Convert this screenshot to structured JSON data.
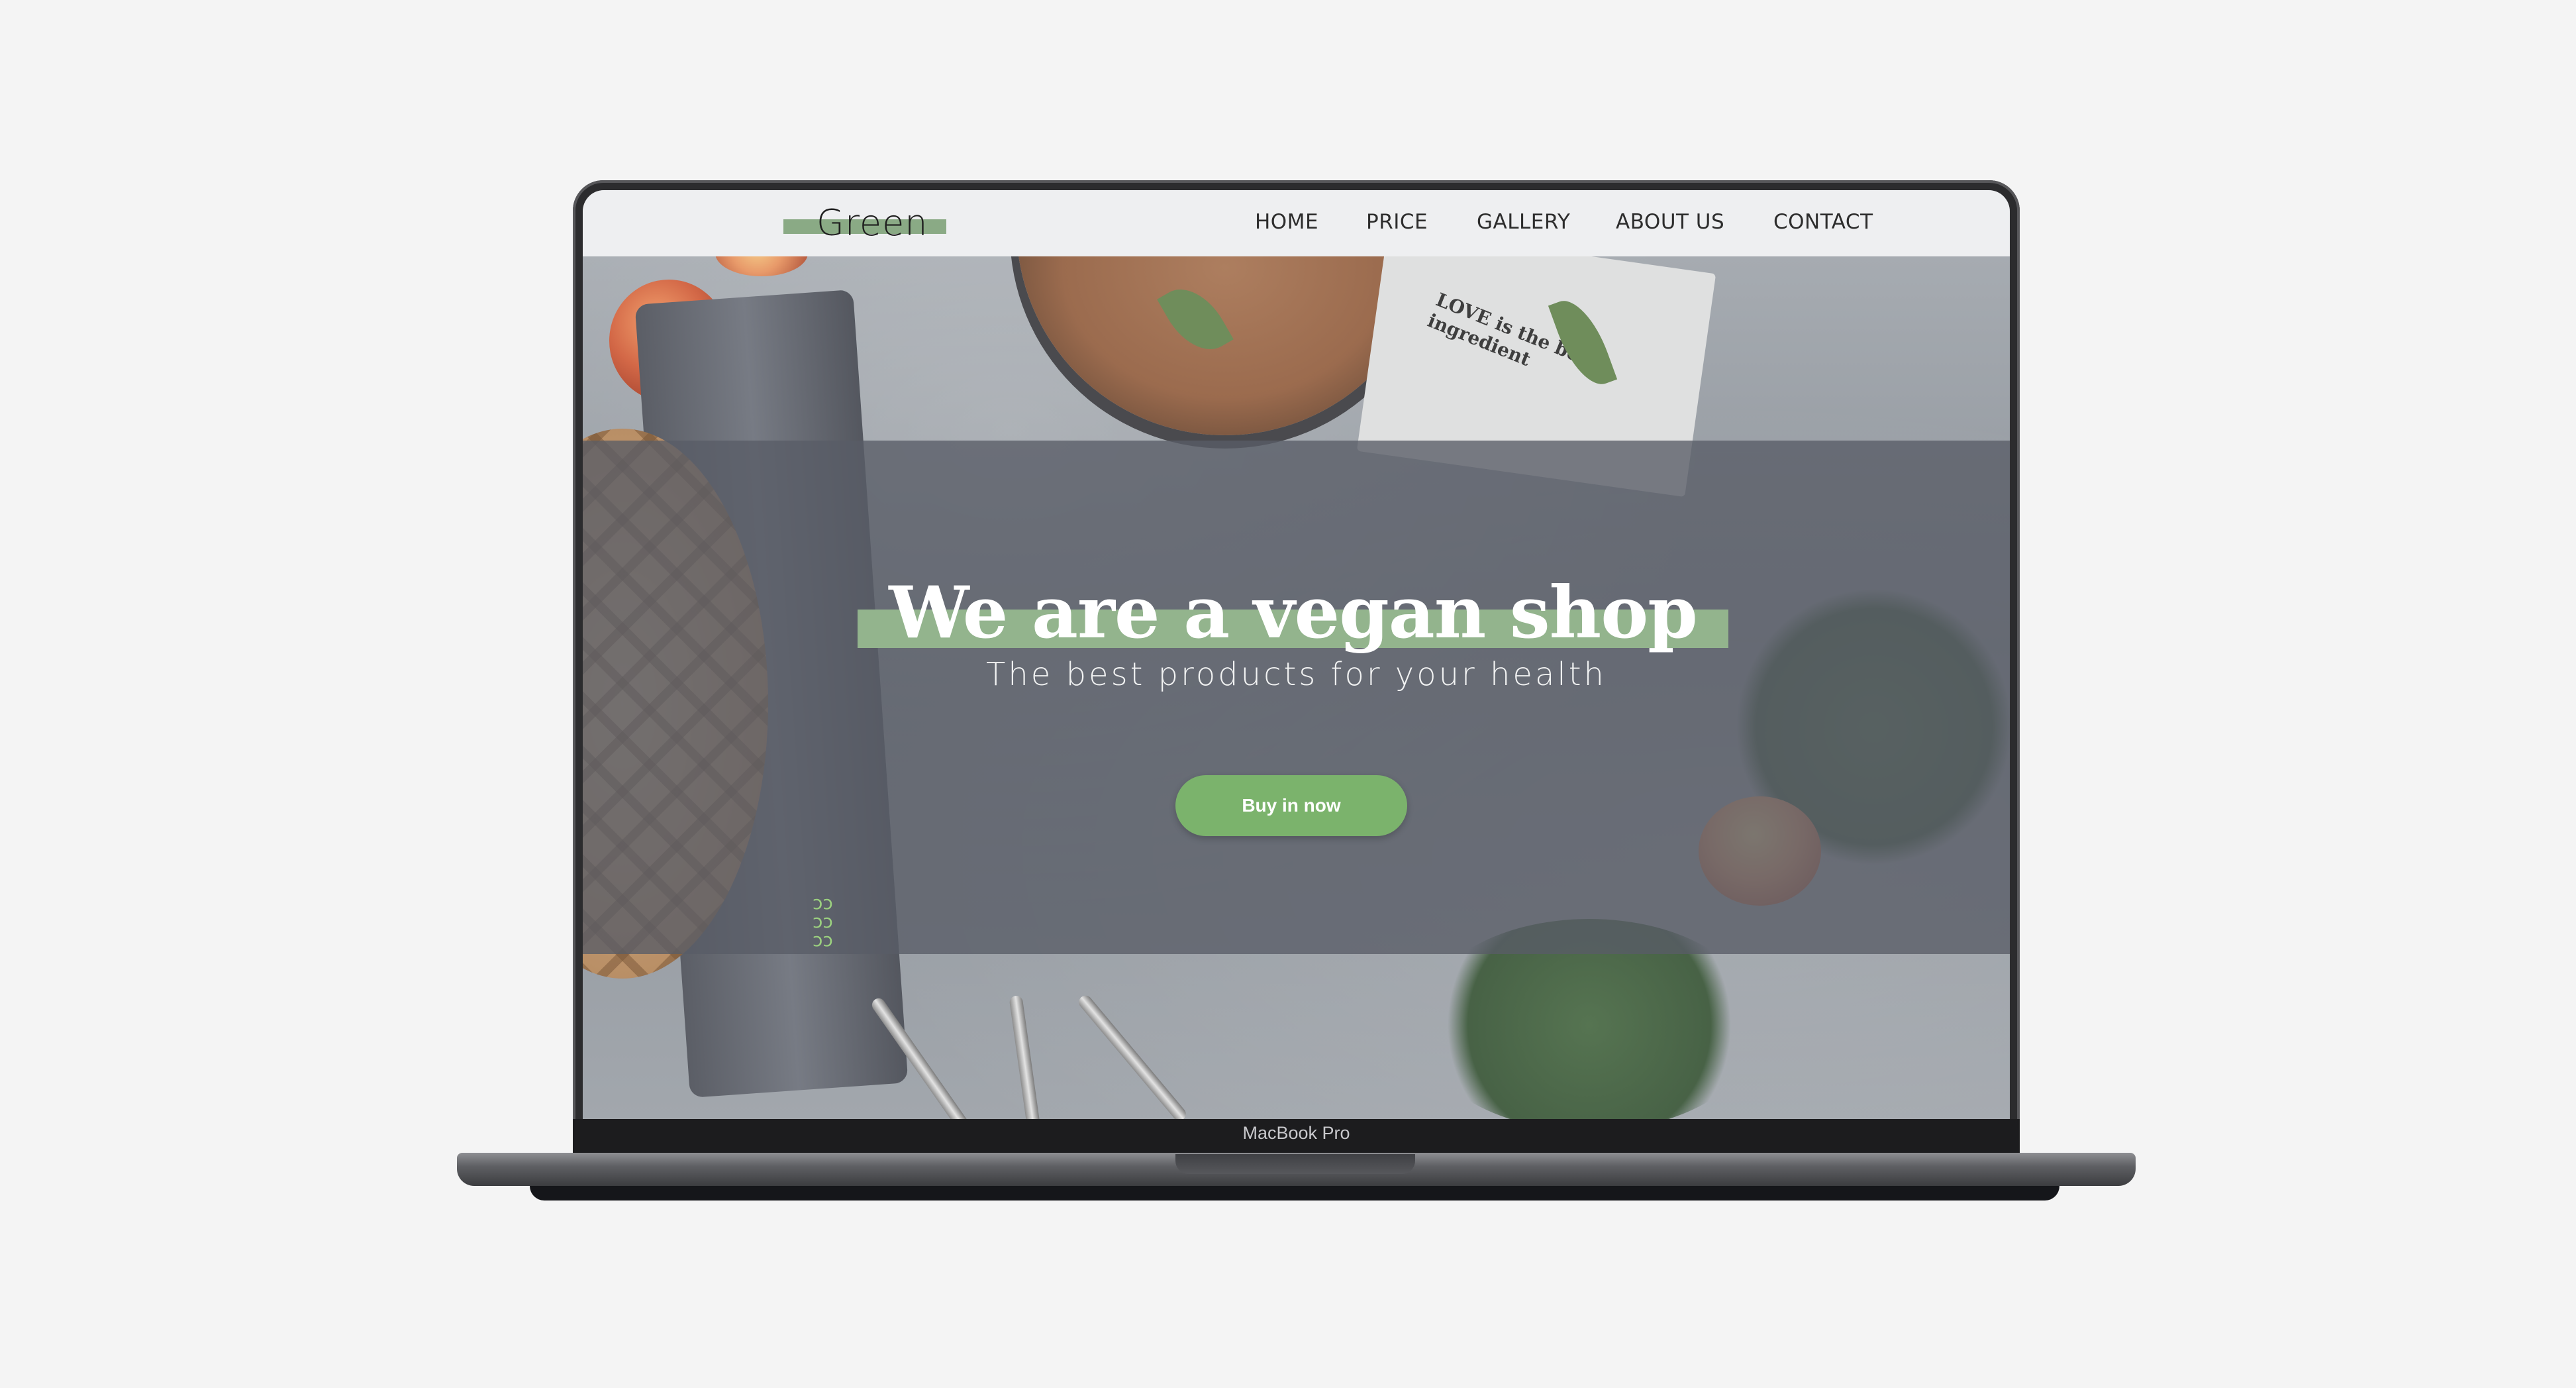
{
  "site": {
    "logo": "Green",
    "nav": [
      "HOME",
      "PRICE",
      "GALLERY",
      "ABOUT  US",
      "CONTACT"
    ]
  },
  "hero": {
    "headline": "We are a vegan shop",
    "subheadline": "The best products for your health",
    "cta_label": "Buy in now",
    "napkin_text": "LOVE is the best ingredient"
  },
  "device": {
    "model_label": "MacBook Pro"
  },
  "colors": {
    "accent_green": "#7bb36c",
    "highlight_green": "#93b48d",
    "logo_bar": "#8aaa85",
    "header_bg": "#eeeff1",
    "overlay": "#585c66"
  }
}
